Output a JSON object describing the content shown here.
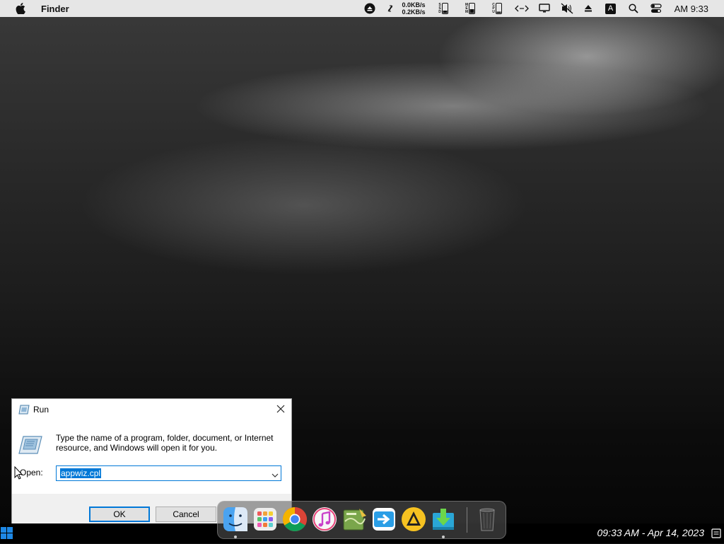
{
  "menubar": {
    "app_name": "Finder",
    "net_up": "0.0KB/s",
    "net_down": "0.2KB/s",
    "ssd_label": "SSD",
    "mem_label": "MEM",
    "cpu_label": "CPU",
    "keyboard_letter": "A",
    "clock": "AM 9:33"
  },
  "run_dialog": {
    "title": "Run",
    "description": "Type the name of a program, folder, document, or Internet resource, and Windows will open it for you.",
    "open_label": "Open:",
    "open_value": "appwiz.cpl",
    "ok_label": "OK",
    "cancel_label": "Cancel"
  },
  "taskbar": {
    "datetime": "09:33 AM - Apr 14, 2023"
  },
  "dock": {
    "items": [
      {
        "name": "finder-icon",
        "running": true
      },
      {
        "name": "launchpad-icon",
        "running": false
      },
      {
        "name": "chrome-icon",
        "running": false
      },
      {
        "name": "itunes-icon",
        "running": false
      },
      {
        "name": "script-editor-icon",
        "running": false
      },
      {
        "name": "migration-assistant-icon",
        "running": false
      },
      {
        "name": "vlc-icon",
        "running": false
      },
      {
        "name": "downloads-icon",
        "running": true
      },
      {
        "name": "trash-icon",
        "running": false
      }
    ]
  },
  "colors": {
    "selection": "#0078d7",
    "menubar_bg": "#e6e6e6",
    "taskbar_bg": "#000000"
  }
}
